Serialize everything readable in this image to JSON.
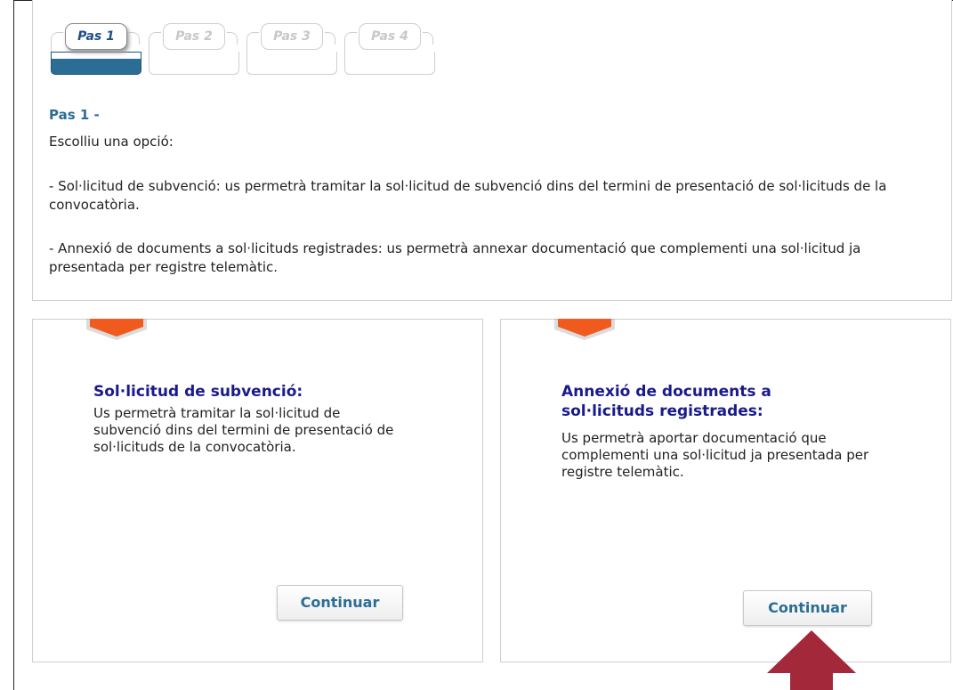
{
  "steps": [
    {
      "label": "Pas 1",
      "active": true
    },
    {
      "label": "Pas 2",
      "active": false
    },
    {
      "label": "Pas 3",
      "active": false
    },
    {
      "label": "Pas 4",
      "active": false
    }
  ],
  "intro": {
    "title": "Pas 1 -",
    "prompt": "Escolliu una opció:",
    "option1_text": "- Sol·licitud de subvenció: us permetrà tramitar la sol·licitud de subvenció dins del termini de presentació de sol·licituds de la convocatòria.",
    "option2_text": "- Annexió de documents a sol·licituds registrades: us permetrà annexar documentació que complementi una sol·licitud ja presentada per registre telemàtic."
  },
  "cards": [
    {
      "title": "Sol·licitud de subvenció:",
      "text": "Us permetrà tramitar la sol·licitud de subvenció dins del termini de presentació de sol·licituds de la convocatòria.",
      "button_label": "Continuar"
    },
    {
      "title": "Annexió de documents a sol·licituds registrades:",
      "text": "Us permetrà aportar documentació que complementi una sol·licitud ja presentada per registre telemàtic.",
      "button_label": "Continuar"
    }
  ],
  "colors": {
    "accent": "#2b6d95",
    "card_title": "#1a1a8c",
    "ribbon": "#f05a1e",
    "arrow": "#a3293a"
  },
  "icons": {
    "ribbon": "orange-ribbon-icon",
    "annotation_arrow": "up-arrow-icon"
  }
}
